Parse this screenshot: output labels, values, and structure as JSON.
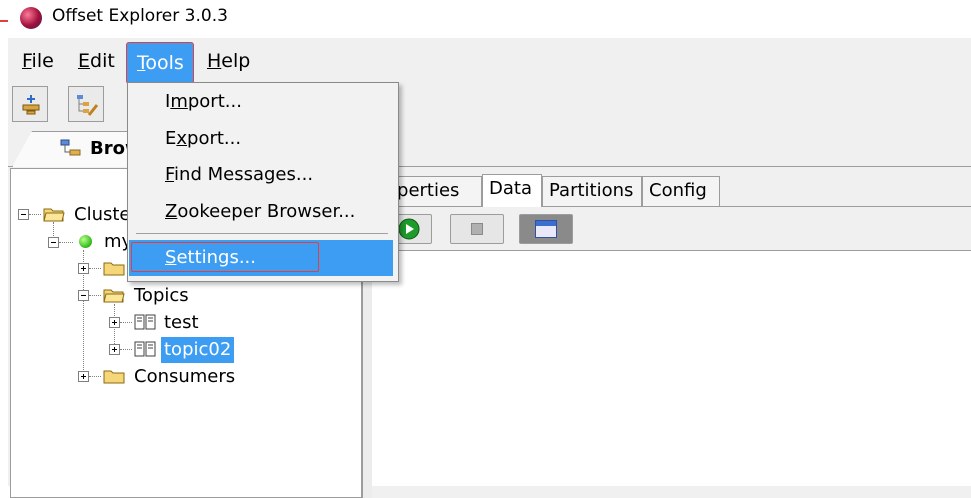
{
  "window": {
    "title": "Offset Explorer  3.0.3"
  },
  "menubar": {
    "file": {
      "mnemonic": "F",
      "rest": "ile"
    },
    "edit": {
      "mnemonic": "E",
      "rest": "dit"
    },
    "tools": {
      "mnemonic": "T",
      "rest": "ools"
    },
    "help": {
      "mnemonic": "H",
      "rest": "elp"
    }
  },
  "tools_menu": {
    "items": [
      {
        "before": "I",
        "mnemonic": "m",
        "after": "port..."
      },
      {
        "before": "E",
        "mnemonic": "x",
        "after": "port..."
      },
      {
        "before": "",
        "mnemonic": "F",
        "after": "ind Messages..."
      },
      {
        "before": "",
        "mnemonic": "Z",
        "after": "ookeeper Browser..."
      },
      {
        "before": "",
        "mnemonic": "S",
        "after": "ettings..."
      }
    ],
    "highlighted_index": 4
  },
  "left_tab": {
    "label": "Brow"
  },
  "tree": {
    "root": "Cluste",
    "connection": "my",
    "topics_label": "Topics",
    "topics": [
      "test",
      "topic02"
    ],
    "selected_topic": "topic02",
    "consumers_label": "Consumers"
  },
  "right_tabs": {
    "properties": "roperties",
    "data": "Data",
    "partitions": "Partitions",
    "config": "Config",
    "active": "Data"
  },
  "colors": {
    "selection": "#3d9df3",
    "annotation_box": "#e04040",
    "status_connected": "#2fb81a"
  }
}
